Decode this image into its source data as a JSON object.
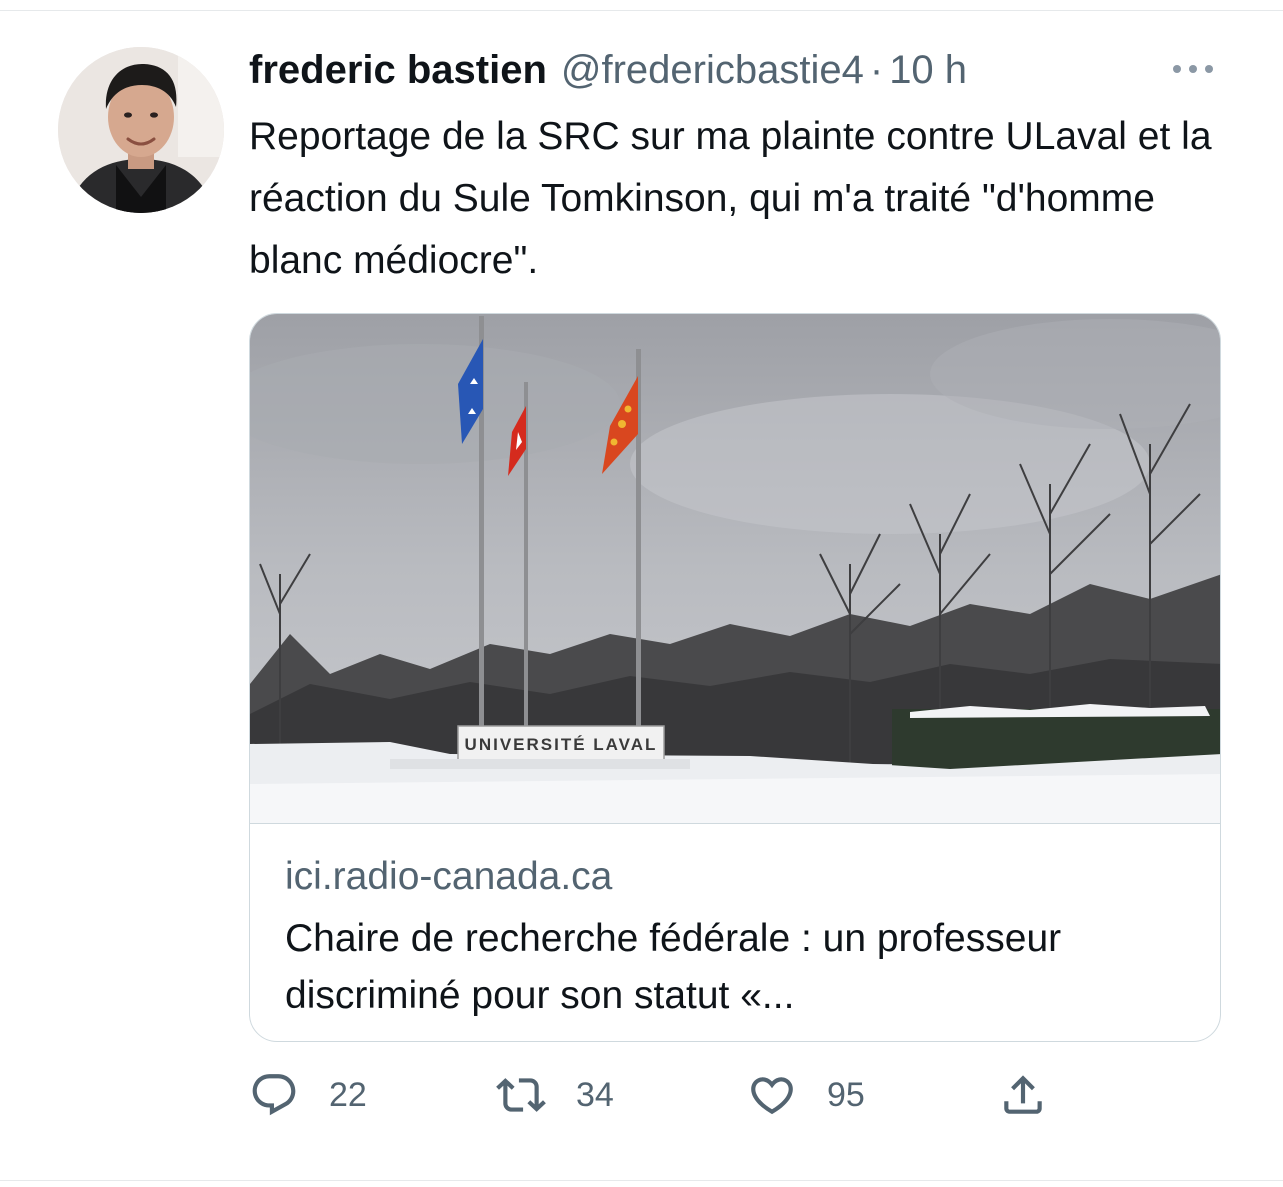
{
  "tweet": {
    "author_name": "frederic bastien",
    "author_handle": "@fredericbastie4",
    "separator": "·",
    "timestamp": "10 h",
    "text": "Reportage de la SRC sur ma plainte contre ULaval et la réaction du Sule Tomkinson, qui m'a traité \"d'homme blanc médiocre\"."
  },
  "card": {
    "image_sign": "UNIVERSITÉ LAVAL",
    "domain": "ici.radio-canada.ca",
    "title": "Chaire de recherche fédérale : un professeur discriminé pour son statut «..."
  },
  "actions": {
    "reply_count": "22",
    "retweet_count": "34",
    "like_count": "95"
  },
  "icons": {
    "more": "more-horizontal-icon",
    "reply": "reply-icon",
    "retweet": "retweet-icon",
    "like": "heart-icon",
    "share": "share-icon"
  },
  "colors": {
    "primary_text": "#0f1419",
    "secondary_text": "#536471",
    "border": "#cfd9de"
  }
}
